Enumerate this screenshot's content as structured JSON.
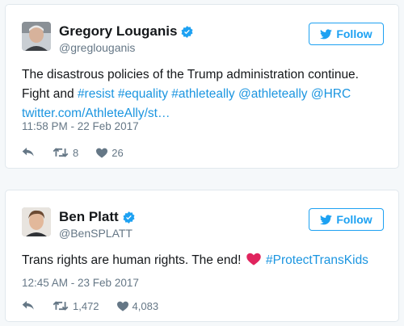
{
  "tweets": [
    {
      "display_name": "Gregory Louganis",
      "handle": "@greglouganis",
      "follow_label": "Follow",
      "text_parts": {
        "p1": "The disastrous policies of the Trump administration continue. Fight and ",
        "tag_resist": "#resist",
        "tag_equality": "#equality",
        "tag_athleteally": "#athleteally",
        "mention_athleteally": "@athleteally",
        "mention_hrc": "@HRC",
        "link": "twitter.com/AthleteAlly/st…"
      },
      "timestamp": "11:58 PM - 22 Feb 2017",
      "retweets": "8",
      "likes": "26"
    },
    {
      "display_name": "Ben Platt",
      "handle": "@BenSPLATT",
      "follow_label": "Follow",
      "text_parts": {
        "p1": "Trans rights are human rights. The end!",
        "hashtag": "#ProtectTransKids"
      },
      "timestamp": "12:45 AM - 23 Feb 2017",
      "retweets": "1,472",
      "likes": "4,083"
    }
  ],
  "colors": {
    "accent": "#1da1f2",
    "link": "#1b95e0",
    "muted": "#657786",
    "heart_emoji": "#e0245e"
  },
  "icons": [
    "verified-icon",
    "bird-icon",
    "reply-icon",
    "retweet-icon",
    "like-icon",
    "heart-emoji"
  ]
}
